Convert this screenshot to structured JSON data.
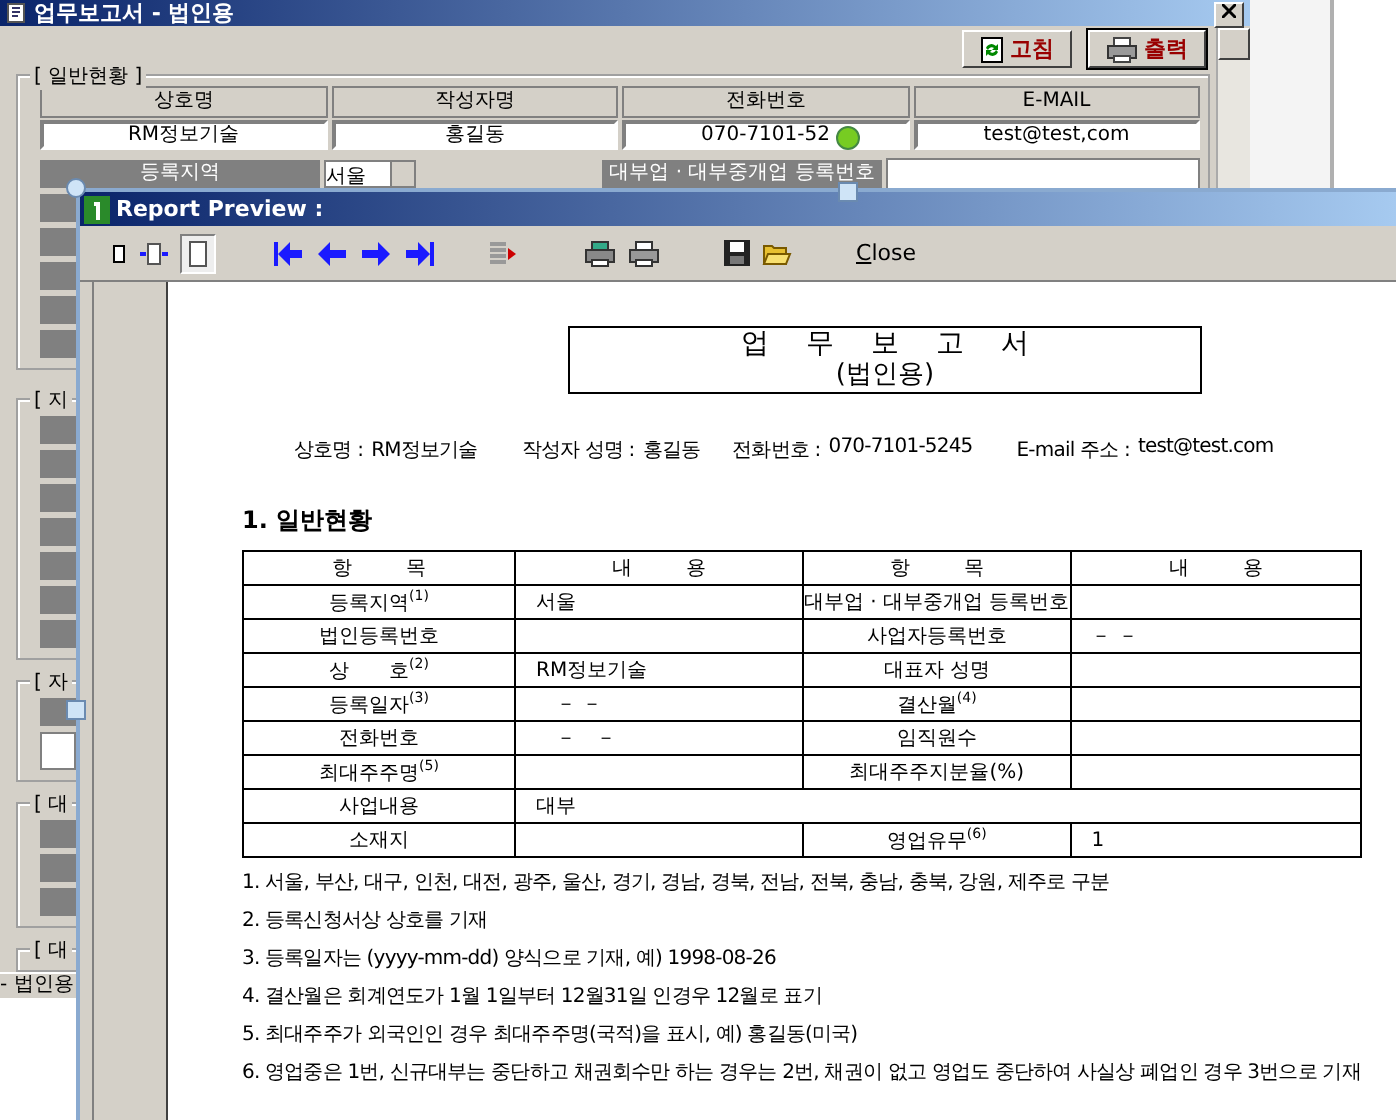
{
  "main_window": {
    "title": "업무보고서 - 법인용",
    "buttons": [
      {
        "label": "고침",
        "kind": "refresh",
        "selected": false
      },
      {
        "label": "출력",
        "kind": "print",
        "selected": true
      }
    ],
    "general_section": {
      "title": "[ 일반현황 ]",
      "columns": [
        "상호명",
        "작성자명",
        "전화번호",
        "E-MAIL"
      ],
      "values": [
        "RM정보기술",
        "홍길동",
        "070-7101-52",
        "test@test,com"
      ],
      "region_label": "등록지역",
      "region_value": "서울",
      "loan_label": "대부업 · 대부중개업 등록번호"
    },
    "partial_sections": [
      "[ 지",
      "[ 자",
      "[ 대",
      "[ 대"
    ],
    "lower_window_title": "- 법인용"
  },
  "preview": {
    "title": "Report Preview :",
    "close": "Close",
    "report": {
      "title": "업 무 보 고 서",
      "subtitle": "(법인용)",
      "info": [
        {
          "label": "상호명 :",
          "value": "RM정보기술"
        },
        {
          "label": "작성자 성명 :",
          "value": "홍길동"
        },
        {
          "label": "전화번호 :",
          "value": "070-7101-5245"
        },
        {
          "label": "E-mail 주소 :",
          "value": "test@test.com"
        }
      ],
      "section_heading": "1. 일반현황",
      "table": [
        [
          {
            "text": "항 목",
            "kind": "head"
          },
          {
            "text": "내 용",
            "kind": "head"
          },
          {
            "text": "항 목",
            "kind": "head"
          },
          {
            "text": "내 용",
            "kind": "head"
          }
        ],
        [
          {
            "text": "등록지역$^{(1)}$",
            "kind": "item"
          },
          {
            "text": "서울",
            "kind": "value"
          },
          {
            "text": "대부업 · 대부중개업 등록번호",
            "kind": "item"
          },
          {
            "kind": "value"
          }
        ],
        [
          {
            "text": "법인등록번호",
            "kind": "item"
          },
          {
            "kind": "value"
          },
          {
            "text": "사업자등록번호",
            "kind": "item"
          },
          {
            "text": "－ －",
            "kind": "value"
          }
        ],
        [
          {
            "text": "상　　호$^{(2)}$",
            "kind": "item"
          },
          {
            "text": "RM정보기술",
            "kind": "value"
          },
          {
            "text": "대표자 성명",
            "kind": "item"
          },
          {
            "kind": "value"
          }
        ],
        [
          {
            "text": "등록일자$^{(3)}$",
            "kind": "item"
          },
          {
            "text": "　－ －",
            "kind": "value"
          },
          {
            "text": "결산월$^{(4)}$",
            "kind": "item"
          },
          {
            "kind": "value"
          }
        ],
        [
          {
            "text": "전화번호",
            "kind": "item"
          },
          {
            "text": "　－　－",
            "kind": "value"
          },
          {
            "text": "임직원수",
            "kind": "item"
          },
          {
            "kind": "value"
          }
        ],
        [
          {
            "text": "최대주주명$^{(5)}$",
            "kind": "item"
          },
          {
            "kind": "value"
          },
          {
            "text": "최대주주지분율(%)",
            "kind": "item"
          },
          {
            "kind": "value"
          }
        ],
        [
          {
            "text": "사업내용",
            "kind": "item"
          },
          {
            "text": "대부",
            "kind": "wide"
          }
        ],
        [
          {
            "text": "소재지",
            "kind": "item"
          },
          {
            "kind": "value"
          },
          {
            "text": "영업유무$^{(6)}$",
            "kind": "item"
          },
          {
            "text": "1",
            "kind": "value"
          }
        ]
      ],
      "notes": [
        "1. 서울, 부산, 대구, 인천, 대전, 광주, 울산, 경기, 경남, 경북, 전남, 전북, 충남, 충북, 강원, 제주로 구분",
        "2. 등록신청서상 상호를 기재",
        "3. 등록일자는 (yyyy-mm-dd) 양식으로 기재, 예) 1998-08-26",
        "4. 결산월은 회계연도가 1월 1일부터 12월31일 인경우 12월로 표기",
        "5. 최대주주가 외국인인 경우 최대주주명(국적)을 표시, 예) 홍길동(미국)",
        "6. 영업중은 1번, 신규대부는 중단하고 채권회수만 하는 경우는 2번, 채권이 없고 영업도 중단하여 사실상 폐업인 경우 3번으로 기재"
      ]
    }
  }
}
